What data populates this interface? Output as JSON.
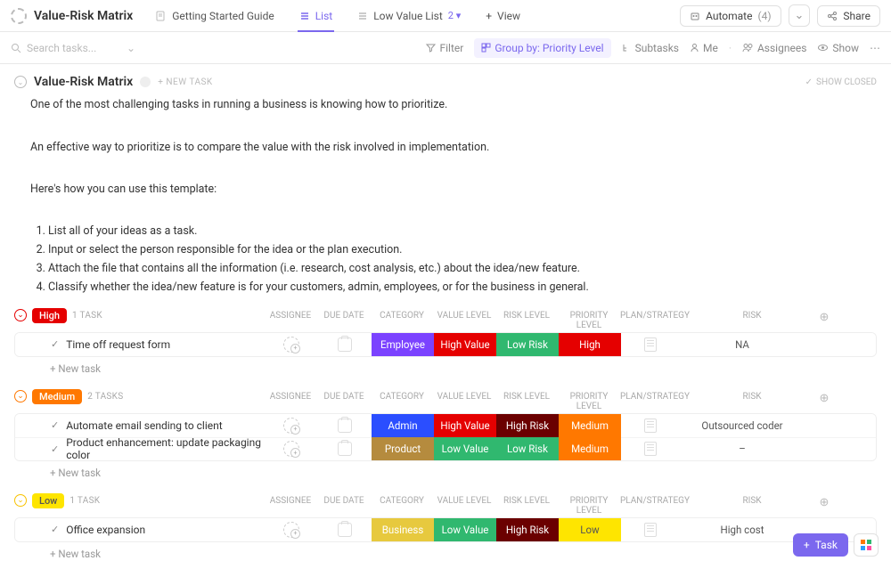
{
  "header": {
    "title": "Value-Risk Matrix",
    "tabs": {
      "guide": "Getting Started Guide",
      "list": "List",
      "low_value": "Low Value List",
      "low_value_badge": "2 ▾",
      "view": "View"
    },
    "automate": "Automate",
    "automate_count": "(4)",
    "share": "Share"
  },
  "toolbar": {
    "search_placeholder": "Search tasks...",
    "filter": "Filter",
    "group_by": "Group by: Priority Level",
    "subtasks": "Subtasks",
    "me": "Me",
    "assignees": "Assignees",
    "show": "Show"
  },
  "section": {
    "title": "Value-Risk Matrix",
    "new_task": "+ NEW TASK",
    "show_closed": "SHOW CLOSED"
  },
  "desc": {
    "p1": "One of the most challenging tasks in running a business is knowing how to prioritize.",
    "p2": "An effective way to prioritize is to compare the value with the risk involved in implementation.",
    "p3": "Here's how you can use this template:",
    "li1": "List all of your ideas as a task.",
    "li2": "Input or select the person responsible for the idea or the plan execution.",
    "li3": "Attach the file that contains all the information (i.e. research, cost analysis, etc.) about the idea/new feature.",
    "li4": "Classify whether the idea/new feature is for your customers, admin, employees, or for the business in general."
  },
  "columns": {
    "assignee": "ASSIGNEE",
    "due": "DUE DATE",
    "category": "CATEGORY",
    "value": "VALUE LEVEL",
    "risk": "RISK LEVEL",
    "priority": "PRIORITY LEVEL",
    "plan": "PLAN/STRATEGY",
    "risk2": "RISK"
  },
  "labels": {
    "new_task_row": "+ New task"
  },
  "groups": {
    "high": {
      "label": "High",
      "count": "1 TASK",
      "tasks": [
        {
          "name": "Time off request form",
          "category": "Employee",
          "cat_cls": "bg-employee",
          "value": "High Value",
          "val_cls": "bg-highval",
          "risk": "Low Risk",
          "rsk_cls": "bg-lowrisk",
          "priority": "High",
          "pri_cls": "bg-pri-high",
          "risk2": "NA"
        }
      ]
    },
    "medium": {
      "label": "Medium",
      "count": "2 TASKS",
      "tasks": [
        {
          "name": "Automate email sending to client",
          "category": "Admin",
          "cat_cls": "bg-admin",
          "value": "High Value",
          "val_cls": "bg-highval",
          "risk": "High Risk",
          "rsk_cls": "bg-highrisk",
          "priority": "Medium",
          "pri_cls": "bg-pri-med",
          "risk2": "Outsourced coder"
        },
        {
          "name": "Product enhancement: update packaging color",
          "category": "Product",
          "cat_cls": "bg-product",
          "value": "Low Value",
          "val_cls": "bg-lowval",
          "risk": "Low Risk",
          "rsk_cls": "bg-lowrisk",
          "priority": "Medium",
          "pri_cls": "bg-pri-med",
          "risk2": "–"
        }
      ]
    },
    "low": {
      "label": "Low",
      "count": "1 TASK",
      "tasks": [
        {
          "name": "Office expansion",
          "category": "Business",
          "cat_cls": "bg-business",
          "value": "Low Value",
          "val_cls": "bg-lowval",
          "risk": "High Risk",
          "rsk_cls": "bg-highrisk",
          "priority": "Low",
          "pri_cls": "bg-pri-low",
          "risk2": "High cost"
        }
      ]
    }
  },
  "fab": {
    "task": "Task"
  }
}
